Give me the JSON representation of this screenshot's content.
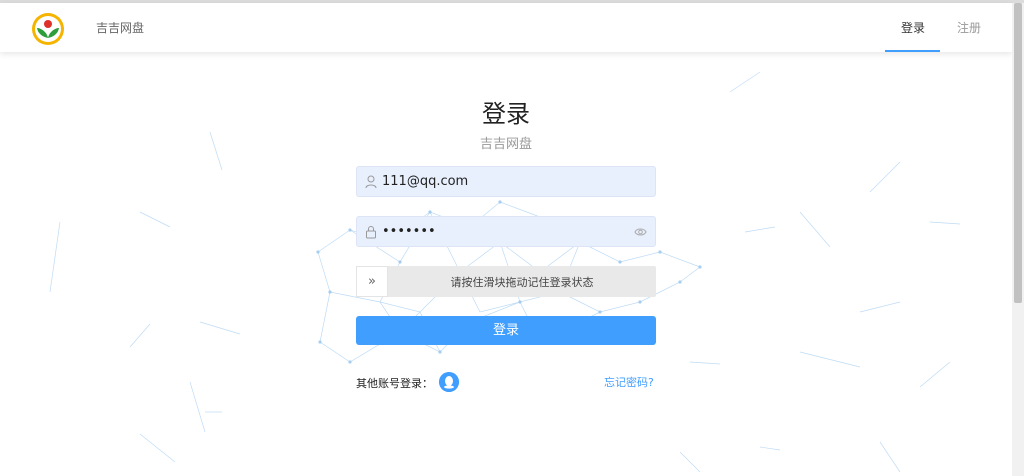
{
  "header": {
    "brand": "吉吉网盘",
    "nav": {
      "login": "登录",
      "register": "注册"
    }
  },
  "form": {
    "title": "登录",
    "subtitle": "吉吉网盘",
    "username_value": "111@qq.com",
    "password_value": "•••••••",
    "slider_text": "请按住滑块拖动记住登录状态",
    "slider_handle_glyph": "»",
    "submit_label": "登录",
    "other_login_label": "其他账号登录：",
    "forgot_label": "忘记密码?"
  },
  "icons": {
    "logo": "leaf-logo-icon",
    "user": "user-icon",
    "lock": "lock-icon",
    "eye": "eye-icon",
    "qq": "qq-icon"
  },
  "colors": {
    "accent": "#409eff",
    "input_bg": "#e8f0fe",
    "slider_bg": "#e9e9e9",
    "logo_ring": "#f5b400",
    "logo_leaf": "#2e9e3a"
  }
}
